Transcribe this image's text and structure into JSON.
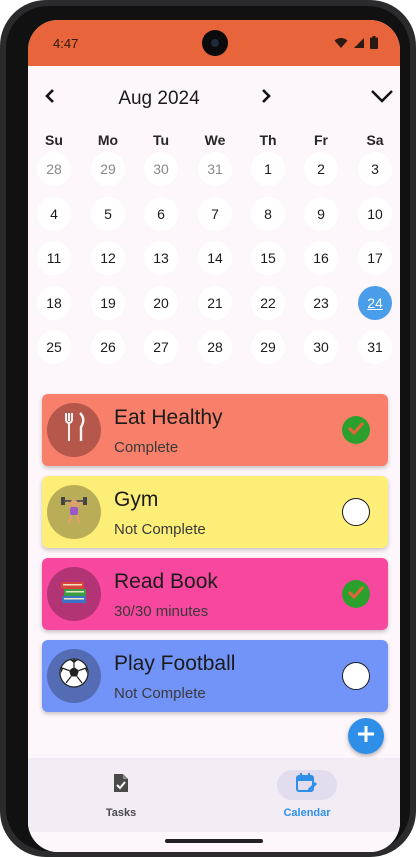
{
  "status_bar": {
    "time": "4:47",
    "color": "#e8643a"
  },
  "calendar": {
    "month_label": "Aug 2024",
    "prev_icon": "chevron-left-icon",
    "next_icon": "chevron-right-icon",
    "collapse_icon": "chevron-down-icon",
    "weekdays": [
      "Su",
      "Mo",
      "Tu",
      "We",
      "Th",
      "Fr",
      "Sa"
    ],
    "weeks": [
      [
        "28",
        "29",
        "30",
        "31",
        "1",
        "2",
        "3"
      ],
      [
        "4",
        "5",
        "6",
        "7",
        "8",
        "9",
        "10"
      ],
      [
        "11",
        "12",
        "13",
        "14",
        "15",
        "16",
        "17"
      ],
      [
        "18",
        "19",
        "20",
        "21",
        "22",
        "23",
        "24"
      ],
      [
        "25",
        "26",
        "27",
        "28",
        "29",
        "30",
        "31"
      ]
    ],
    "selected_day": "24",
    "selected_color": "#4a9de8"
  },
  "habits": [
    {
      "title": "Eat Healthy",
      "status": "Complete",
      "done": true,
      "color": "#f8806a",
      "avatar_color": "#b5574a",
      "icon": "fork-knife-icon"
    },
    {
      "title": "Gym",
      "status": "Not Complete",
      "done": false,
      "color": "#fdee78",
      "avatar_color": "#b9ad58",
      "icon": "weightlifter-icon"
    },
    {
      "title": "Read Book",
      "status": "30/30 minutes",
      "done": true,
      "color": "#f8479e",
      "avatar_color": "#b33475",
      "icon": "books-icon"
    },
    {
      "title": "Play Football",
      "status": "Not Complete",
      "done": false,
      "color": "#7294f8",
      "avatar_color": "#536cb4",
      "icon": "soccer-ball-icon"
    }
  ],
  "fab": {
    "icon": "plus-icon",
    "color": "#2f8fe8"
  },
  "bottom_nav": {
    "items": [
      {
        "label": "Tasks",
        "icon": "task-document-icon",
        "active": false
      },
      {
        "label": "Calendar",
        "icon": "calendar-edit-icon",
        "active": true
      }
    ]
  }
}
